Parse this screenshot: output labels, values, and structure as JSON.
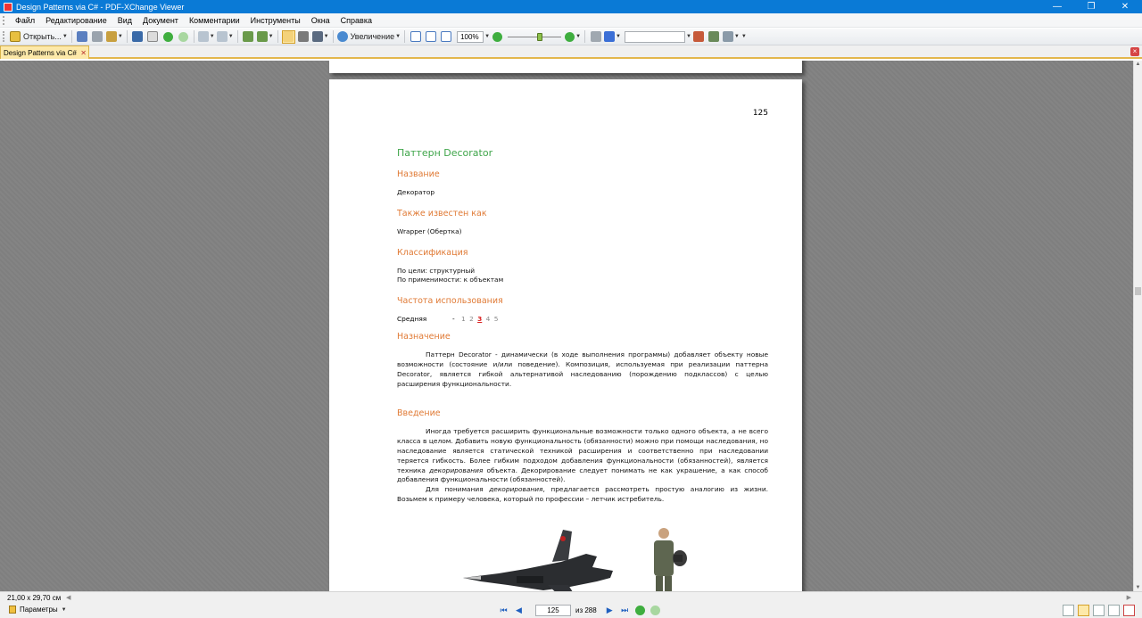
{
  "window": {
    "title": "Design Patterns via C# - PDF-XChange Viewer",
    "minimize": "—",
    "restore": "❐",
    "close": "✕"
  },
  "menu": [
    "Файл",
    "Редактирование",
    "Вид",
    "Документ",
    "Комментарии",
    "Инструменты",
    "Окна",
    "Справка"
  ],
  "toolbar": {
    "open_label": "Открыть...",
    "zoom_label": "Увеличение",
    "zoom_value": "100%",
    "search_value": "",
    "zoom_slider_level": 0.62
  },
  "tab": {
    "label": "Design Patterns via C#",
    "close": "✕"
  },
  "document": {
    "page_number": "125",
    "title": "Паттерн Decorator",
    "sections": {
      "name_heading": "Название",
      "name_value": "Декоратор",
      "aka_heading": "Также известен как",
      "aka_value": "Wrapper (Обертка)",
      "class_heading": "Классификация",
      "class_line1": "По цели: структурный",
      "class_line2": "По применимости: к объектам",
      "freq_heading": "Частота использования",
      "freq_label": "Средняя",
      "freq_dash": "-",
      "freq_scale": [
        "1",
        "2",
        "3",
        "4",
        "5"
      ],
      "freq_selected": 3,
      "purpose_heading": "Назначение",
      "purpose_text": "Паттерн Decorator - динамически (в ходе выполнения программы) добавляет объекту новые возможности (состояние и/или поведение). Композиция, используемая при реализации паттерна Decorator, является гибкой альтернативой наследованию (порождению подклассов) с целью расширения функциональности.",
      "intro_heading": "Введение",
      "intro_p1_a": "Иногда требуется расширить функциональные возможности только одного объекта, а не всего класса в целом. Добавить новую функциональность (обязанности) можно при помощи наследования, но наследование является статической техникой расширения и соответственно при наследовании теряется гибкость. Более гибким подходом добавления функциональности (обязанностей), является техника",
      "intro_p1_em": "декорирования",
      "intro_p1_b": "объекта. Декорирование следует понимать не как украшение, а как способ добавления функциональности (обязанностей).",
      "intro_p2_a": "Для понимания",
      "intro_p2_em": "декорирования",
      "intro_p2_b": ", предлагается рассмотреть простую аналогию из жизни. Возьмем к примеру человека, который по профессии – летчик истребитель."
    }
  },
  "status": {
    "page_size": "21,00 x 29,70 см",
    "params_label": "Параметры",
    "current_page": "125",
    "of_label": "из 288"
  },
  "colors": {
    "titlebar": "#0a7ad6",
    "heading_green": "#3fa54a",
    "heading_orange": "#e07a35",
    "tab_active": "#fde9a9",
    "viewer_bg": "#7f7f7f"
  }
}
